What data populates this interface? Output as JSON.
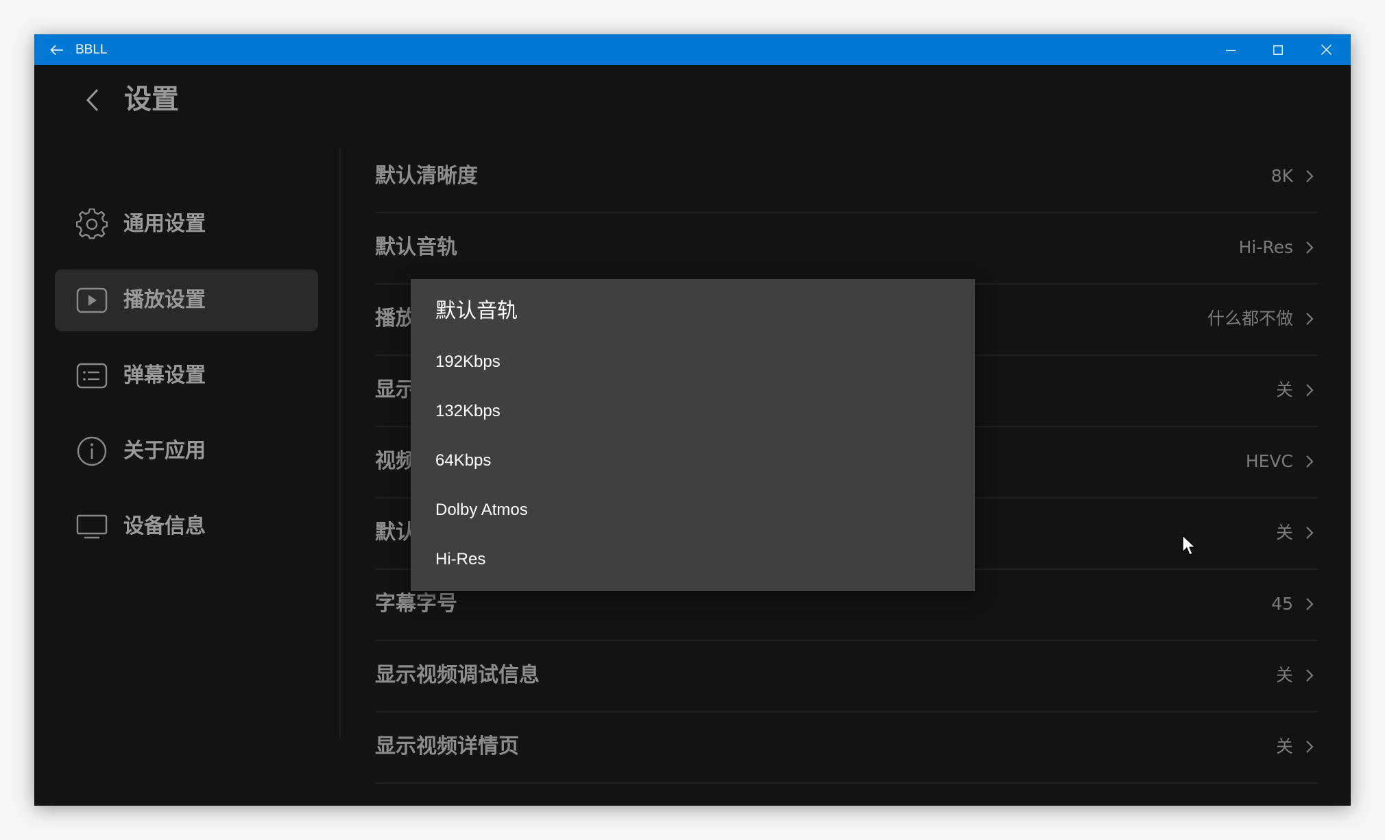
{
  "window": {
    "title": "BBLL"
  },
  "page": {
    "title": "设置"
  },
  "sidebar": {
    "items": [
      {
        "label": "通用设置",
        "icon": "gear-icon",
        "active": false
      },
      {
        "label": "播放设置",
        "icon": "play-icon",
        "active": true
      },
      {
        "label": "弹幕设置",
        "icon": "danmaku-icon",
        "active": false
      },
      {
        "label": "关于应用",
        "icon": "info-icon",
        "active": false
      },
      {
        "label": "设备信息",
        "icon": "monitor-icon",
        "active": false
      }
    ]
  },
  "settings": {
    "rows": [
      {
        "label": "默认清晰度",
        "value": "8K"
      },
      {
        "label": "默认音轨",
        "value": "Hi-Res"
      },
      {
        "label": "播放",
        "value": "什么都不做"
      },
      {
        "label": "显示",
        "value": "关"
      },
      {
        "label": "视频",
        "value": "HEVC"
      },
      {
        "label": "默认",
        "value": "关"
      },
      {
        "label": "字幕字号",
        "value": "45"
      },
      {
        "label": "显示视频调试信息",
        "value": "关"
      },
      {
        "label": "显示视频详情页",
        "value": "关"
      }
    ]
  },
  "dropdown": {
    "title": "默认音轨",
    "options": [
      "192Kbps",
      "132Kbps",
      "64Kbps",
      "Dolby Atmos",
      "Hi-Res"
    ]
  },
  "colors": {
    "titlebar": "#0078d4",
    "background": "#131313",
    "dropdown": "#404040",
    "active_item": "#2a2a2a"
  }
}
